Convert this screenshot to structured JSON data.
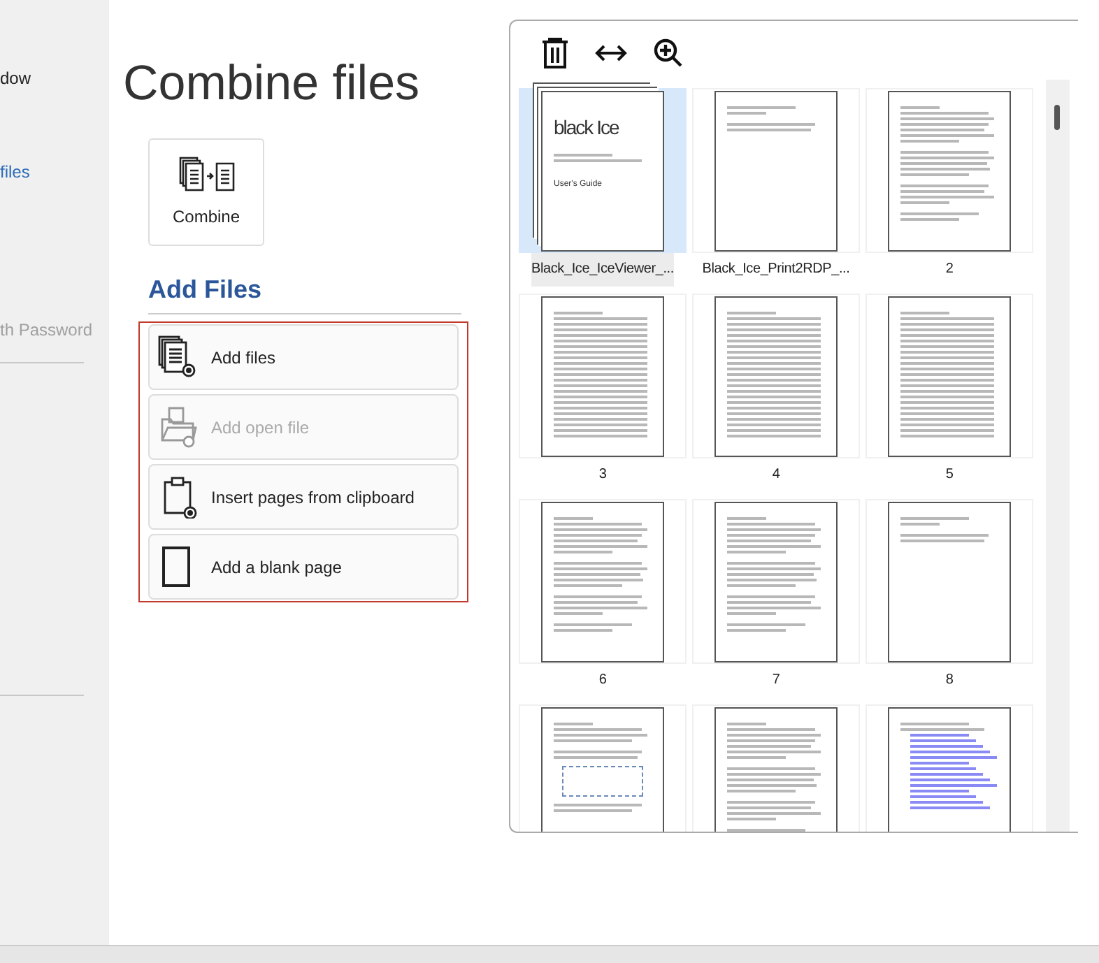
{
  "sidebar": {
    "items": [
      {
        "label": "dow",
        "selected": false,
        "disabled": false
      },
      {
        "label": "files",
        "selected": true,
        "disabled": false
      },
      {
        "label": "th Password",
        "selected": false,
        "disabled": true
      }
    ]
  },
  "title": "Combine files",
  "combine_button": {
    "label": "Combine"
  },
  "add_files": {
    "heading": "Add Files",
    "actions": [
      {
        "label": "Add files",
        "kind": "files",
        "disabled": false
      },
      {
        "label": "Add open file",
        "kind": "open",
        "disabled": true
      },
      {
        "label": "Insert pages from clipboard",
        "kind": "clipboard",
        "disabled": false
      },
      {
        "label": "Add a blank page",
        "kind": "blank",
        "disabled": false
      }
    ]
  },
  "pages": [
    {
      "label": "Black_Ice_IceViewer_...",
      "selected": true,
      "kind": "cover",
      "logo": "black Ice",
      "subtitle": "User's Guide"
    },
    {
      "label": "Black_Ice_Print2RDP_...",
      "selected": false,
      "kind": "title"
    },
    {
      "label": "2",
      "selected": false,
      "kind": "text"
    },
    {
      "label": "3",
      "selected": false,
      "kind": "toc"
    },
    {
      "label": "4",
      "selected": false,
      "kind": "toc"
    },
    {
      "label": "5",
      "selected": false,
      "kind": "toc"
    },
    {
      "label": "6",
      "selected": false,
      "kind": "text"
    },
    {
      "label": "7",
      "selected": false,
      "kind": "text"
    },
    {
      "label": "8",
      "selected": false,
      "kind": "title"
    },
    {
      "selected": false,
      "kind": "diagram"
    },
    {
      "selected": false,
      "kind": "text"
    },
    {
      "selected": false,
      "kind": "links"
    }
  ]
}
